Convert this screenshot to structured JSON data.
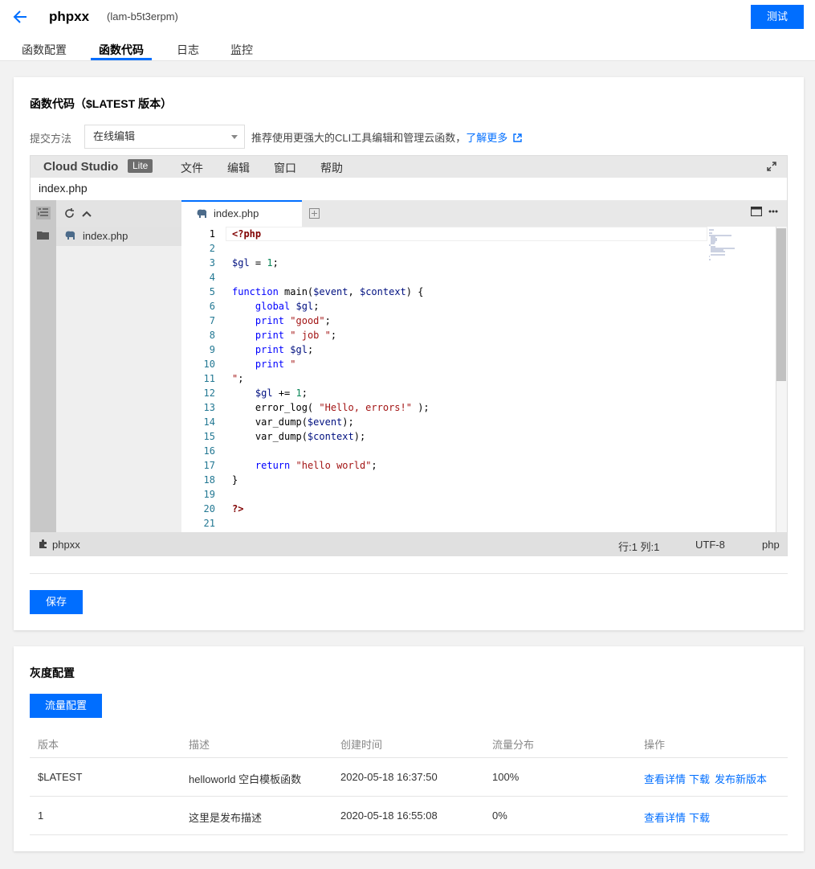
{
  "header": {
    "function_name": "phpxx",
    "function_id": "(lam-b5t3erpm)",
    "test_button": "测试",
    "tabs": [
      "函数配置",
      "函数代码",
      "日志",
      "监控"
    ],
    "active_tab": "函数代码"
  },
  "code_card": {
    "title": "函数代码（$LATEST 版本）",
    "submit_label": "提交方法",
    "submit_method": "在线编辑",
    "hint": "推荐使用更强大的CLI工具编辑和管理云函数，",
    "hint_link": "了解更多",
    "save_button": "保存"
  },
  "ide": {
    "logo": "Cloud Studio",
    "lite_badge": "Lite",
    "menus": [
      "文件",
      "编辑",
      "窗口",
      "帮助"
    ],
    "path": "index.php",
    "tree_file": "index.php",
    "open_tab": "index.php",
    "line_numbers": [
      "1",
      "2",
      "3",
      "4",
      "5",
      "6",
      "7",
      "8",
      "9",
      "10",
      "11",
      "12",
      "13",
      "14",
      "15",
      "16",
      "17",
      "18",
      "19",
      "20",
      "21"
    ],
    "status": {
      "project": "phpxx",
      "position": "行:1 列:1",
      "encoding": "UTF-8",
      "language": "php"
    }
  },
  "gray_card": {
    "title": "灰度配置",
    "flow_button": "流量配置",
    "columns": [
      "版本",
      "描述",
      "创建时间",
      "流量分布",
      "操作"
    ],
    "rows": [
      {
        "version": "$LATEST",
        "desc": "helloworld 空白模板函数",
        "created": "2020-05-18 16:37:50",
        "traffic": "100%",
        "actions": [
          "查看详情",
          "下载",
          "发布新版本"
        ]
      },
      {
        "version": "1",
        "desc": "这里是发布描述",
        "created": "2020-05-18 16:55:08",
        "traffic": "0%",
        "actions": [
          "查看详情",
          "下载"
        ]
      }
    ]
  },
  "colors": {
    "accent": "#006eff"
  }
}
